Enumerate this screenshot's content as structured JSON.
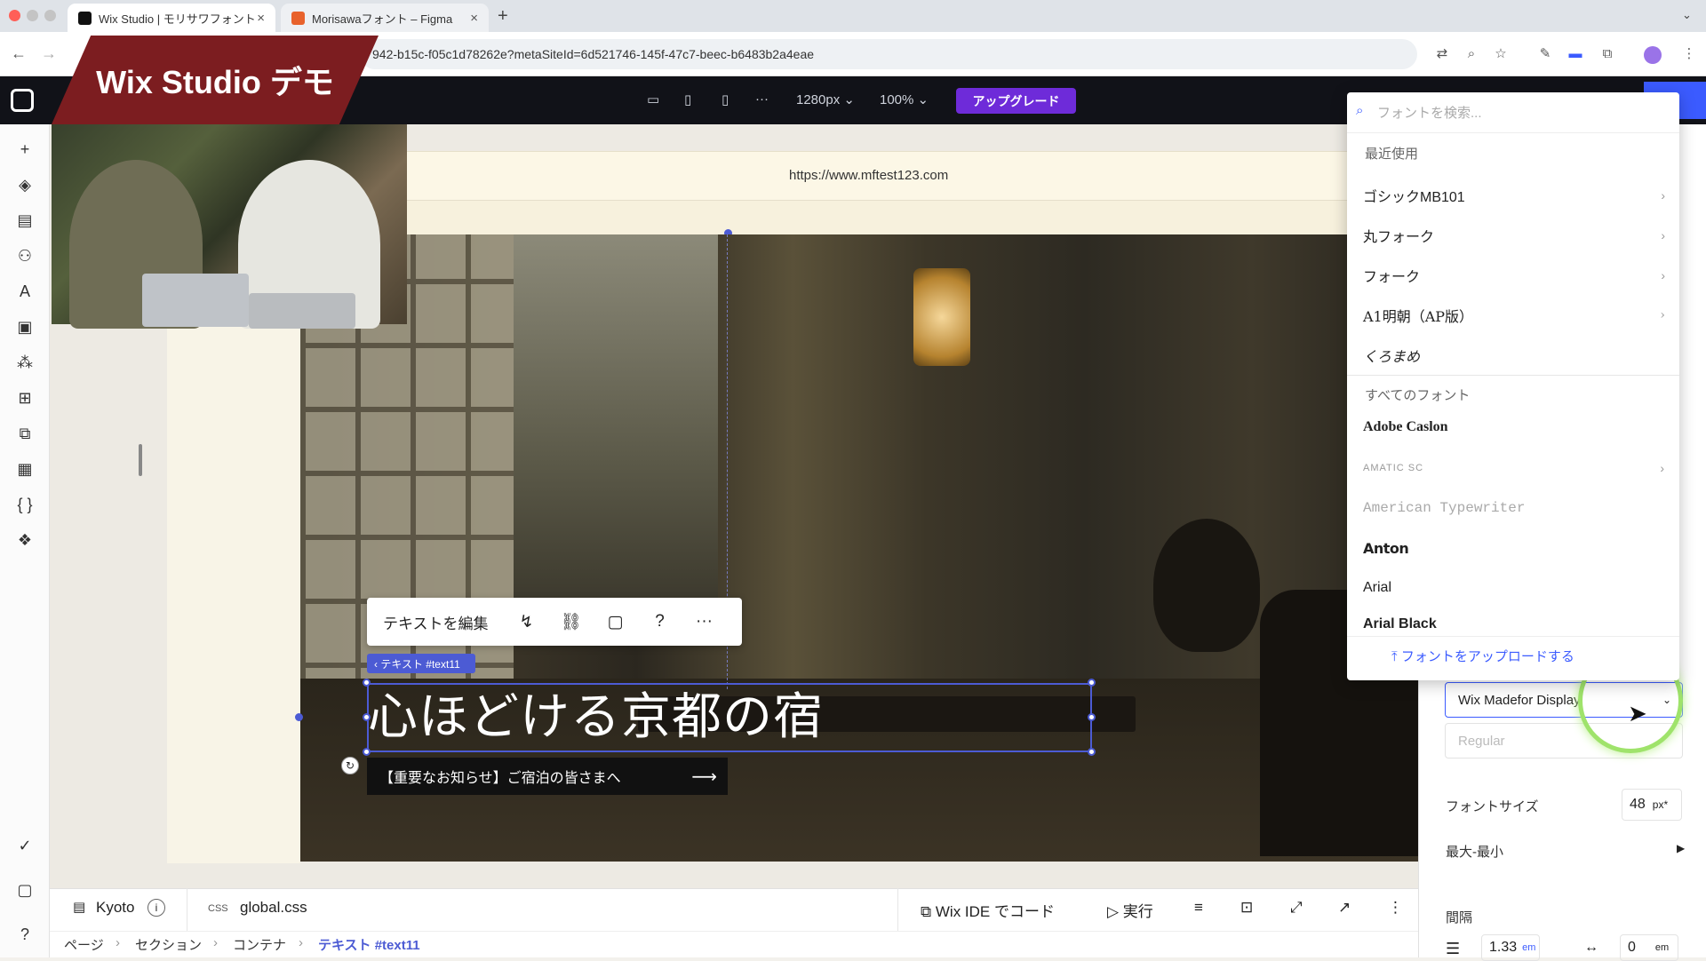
{
  "browser": {
    "tabs": [
      {
        "title": "Wix Studio | モリサワフォント",
        "fav_color": "#111111"
      },
      {
        "title": "Morisawaフォント – Figma",
        "fav_color": "#e8622c"
      }
    ],
    "new_tab_symbol": "+",
    "url": "942-b15c-f05c1d78262e?metaSiteId=6d521746-145f-47c7-beec-b6483b2a4eae",
    "close_symbol": "×"
  },
  "overlay": {
    "banner_title": "Wix Studio デモ"
  },
  "editor": {
    "breakpoint": "1280px",
    "zoom": "100%",
    "upgrade_label": "アップグレード",
    "more_symbol": "···"
  },
  "canvas": {
    "site_url": "https://www.mftest123.com",
    "hero_title": "心ほどける京都の宿",
    "notice_text": "【重要なお知らせ】ご宿泊の皆さまへ",
    "notice_arrow": "⟶",
    "element_tag": "‹ テキスト #text11",
    "toolbar": {
      "edit_text": "テキストを編集",
      "more": "···"
    }
  },
  "font_dropdown": {
    "search_placeholder": "フォントを検索...",
    "recent_heading": "最近使用",
    "recent": [
      {
        "name": "ゴシックMB101",
        "has_sub": true
      },
      {
        "name": "丸フォーク",
        "has_sub": true
      },
      {
        "name": "フォーク",
        "has_sub": true
      },
      {
        "name": "A1明朝（AP版）",
        "has_sub": true
      },
      {
        "name": "くろまめ",
        "has_sub": false
      }
    ],
    "all_heading": "すべてのフォント",
    "all": [
      {
        "name": "Adobe Caslon",
        "has_sub": false
      },
      {
        "name": "AMATIC SC",
        "has_sub": true
      },
      {
        "name": "American Typewriter",
        "has_sub": false
      },
      {
        "name": "Anton",
        "has_sub": false
      },
      {
        "name": "Arial",
        "has_sub": false
      },
      {
        "name": "Arial Black",
        "has_sub": false
      }
    ],
    "upload_label": "フォントをアップロードする"
  },
  "right_panel": {
    "selected_font": "Wix Madefor Display",
    "weight_placeholder": "Regular",
    "font_size_label": "フォントサイズ",
    "font_size_value": "48",
    "font_size_unit": "px*",
    "minmax_label": "最大-最小",
    "spacing_label": "間隔",
    "line_height_value": "1.33",
    "line_height_unit": "em",
    "letter_spacing_value": "0",
    "letter_spacing_unit": "em"
  },
  "bottom": {
    "page_name": "Kyoto",
    "css_tag": "CSS",
    "css_file": "global.css",
    "ide_label": "Wix IDE でコード",
    "run_label": "実行",
    "breadcrumbs": [
      "ページ",
      "セクション",
      "コンテナ",
      "テキスト #text11"
    ]
  },
  "colors": {
    "accent": "#3b5bff",
    "upgrade": "#6e2bd9",
    "selection": "#4c5bd4",
    "banner": "#7c1d20"
  }
}
